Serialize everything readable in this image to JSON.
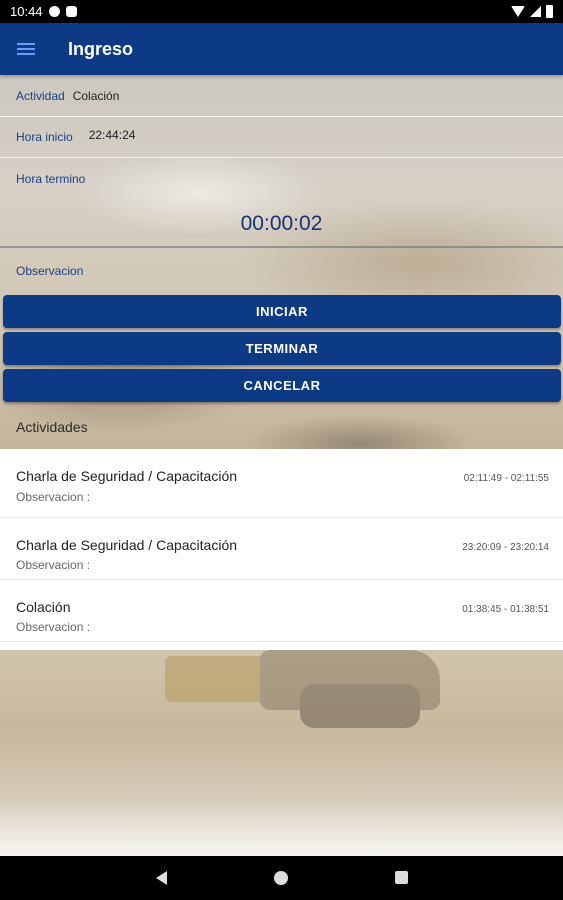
{
  "status_bar": {
    "time": "10:44"
  },
  "app_bar": {
    "title": "Ingreso"
  },
  "form": {
    "actividad_label": "Actividad",
    "actividad_value": "Colación",
    "hora_inicio_label": "Hora inicio",
    "hora_inicio_value": "22:44:24",
    "hora_termino_label": "Hora termino",
    "timer": "00:00:02",
    "observacion_label": "Observacion"
  },
  "buttons": {
    "iniciar": "INICIAR",
    "terminar": "TERMINAR",
    "cancelar": "CANCELAR"
  },
  "activities": {
    "title": "Actividades",
    "items": [
      {
        "name": "Charla de Seguridad / Capacitación",
        "observation": "Observacion :",
        "range": "02:11:49 - 02:11:55"
      },
      {
        "name": "Charla de Seguridad / Capacitación",
        "observation": "Observacion :",
        "range": "23:20:09 - 23:20:14"
      },
      {
        "name": "Colación",
        "observation": "Observacion :",
        "range": "01:38:45 - 01:38:51"
      }
    ]
  },
  "colors": {
    "primary": "#0d3a84",
    "accent": "#6f9bff",
    "label": "#1d3f88"
  },
  "icons": {
    "menu": "hamburger-icon",
    "nav": [
      "back-icon",
      "home-icon",
      "recents-icon"
    ]
  }
}
